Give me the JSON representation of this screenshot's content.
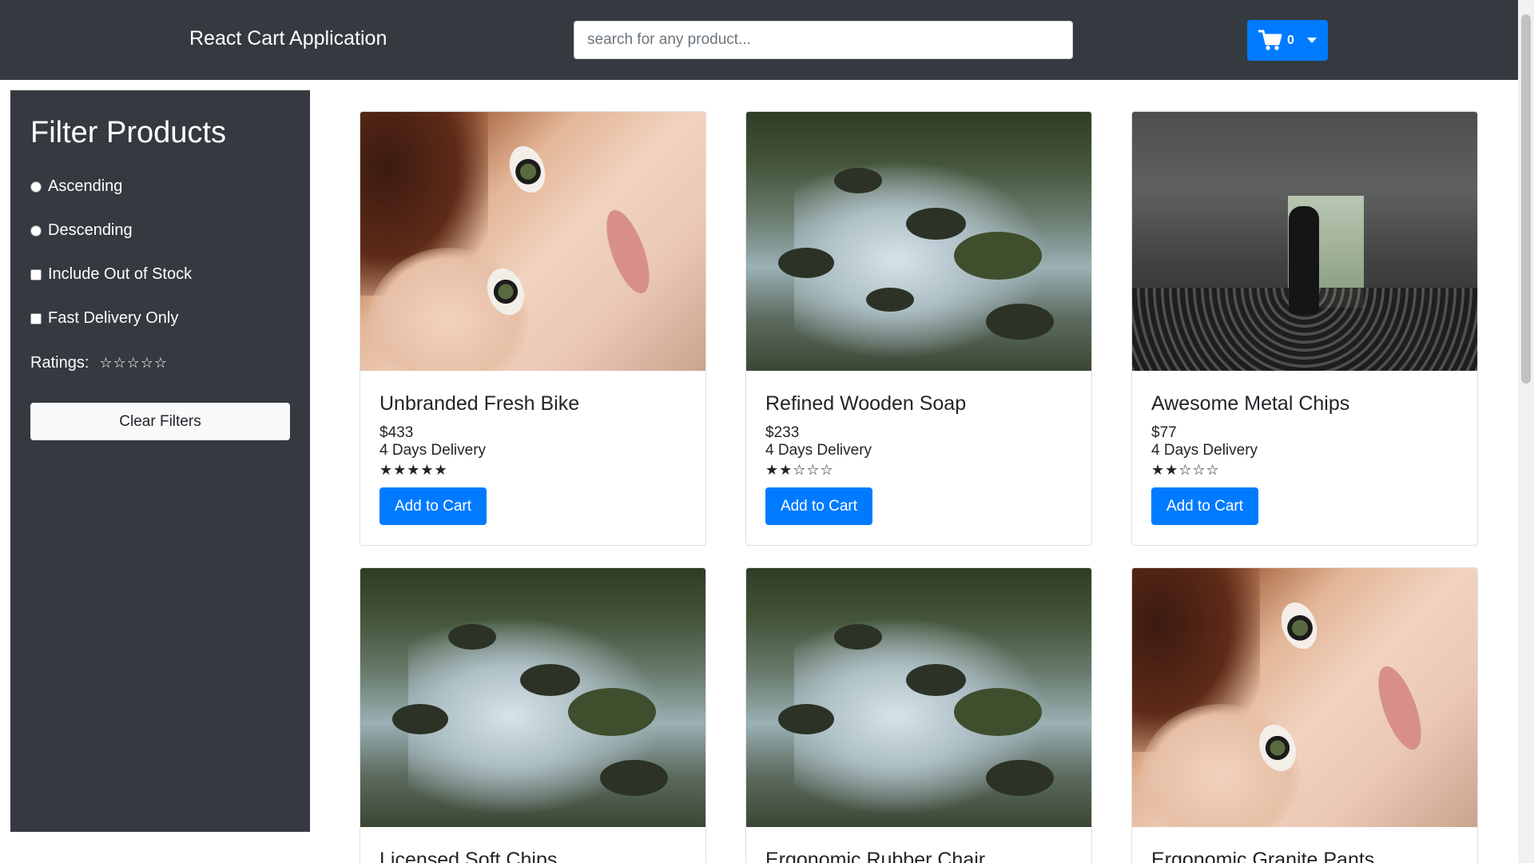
{
  "header": {
    "brand": "React Cart Application",
    "search_placeholder": "search for any product...",
    "cart_count": "0"
  },
  "sidebar": {
    "title": "Filter Products",
    "ascending": "Ascending",
    "descending": "Descending",
    "include_out_of_stock": "Include Out of Stock",
    "fast_delivery": "Fast Delivery Only",
    "ratings_label": "Ratings:",
    "ratings_stars": "☆☆☆☆☆",
    "clear_filters": "Clear Filters"
  },
  "products": [
    {
      "name": "Unbranded Fresh Bike",
      "price": "$433",
      "delivery": "4 Days Delivery",
      "rating": 5,
      "stars": "★★★★★",
      "image": "portrait",
      "button": "Add to Cart"
    },
    {
      "name": "Refined Wooden Soap",
      "price": "$233",
      "delivery": "4 Days Delivery",
      "rating": 2,
      "stars": "★★☆☆☆",
      "image": "stream",
      "button": "Add to Cart"
    },
    {
      "name": "Awesome Metal Chips",
      "price": "$77",
      "delivery": "4 Days Delivery",
      "rating": 2,
      "stars": "★★☆☆☆",
      "image": "tunnel",
      "button": "Add to Cart"
    },
    {
      "name": "Licensed Soft Chips",
      "image": "stream"
    },
    {
      "name": "Ergonomic Rubber Chair",
      "image": "stream"
    },
    {
      "name": "Ergonomic Granite Pants",
      "image": "portrait"
    }
  ],
  "colors": {
    "navbar": "#343a40",
    "primary": "#007bff",
    "sidebar": "#343a40"
  }
}
